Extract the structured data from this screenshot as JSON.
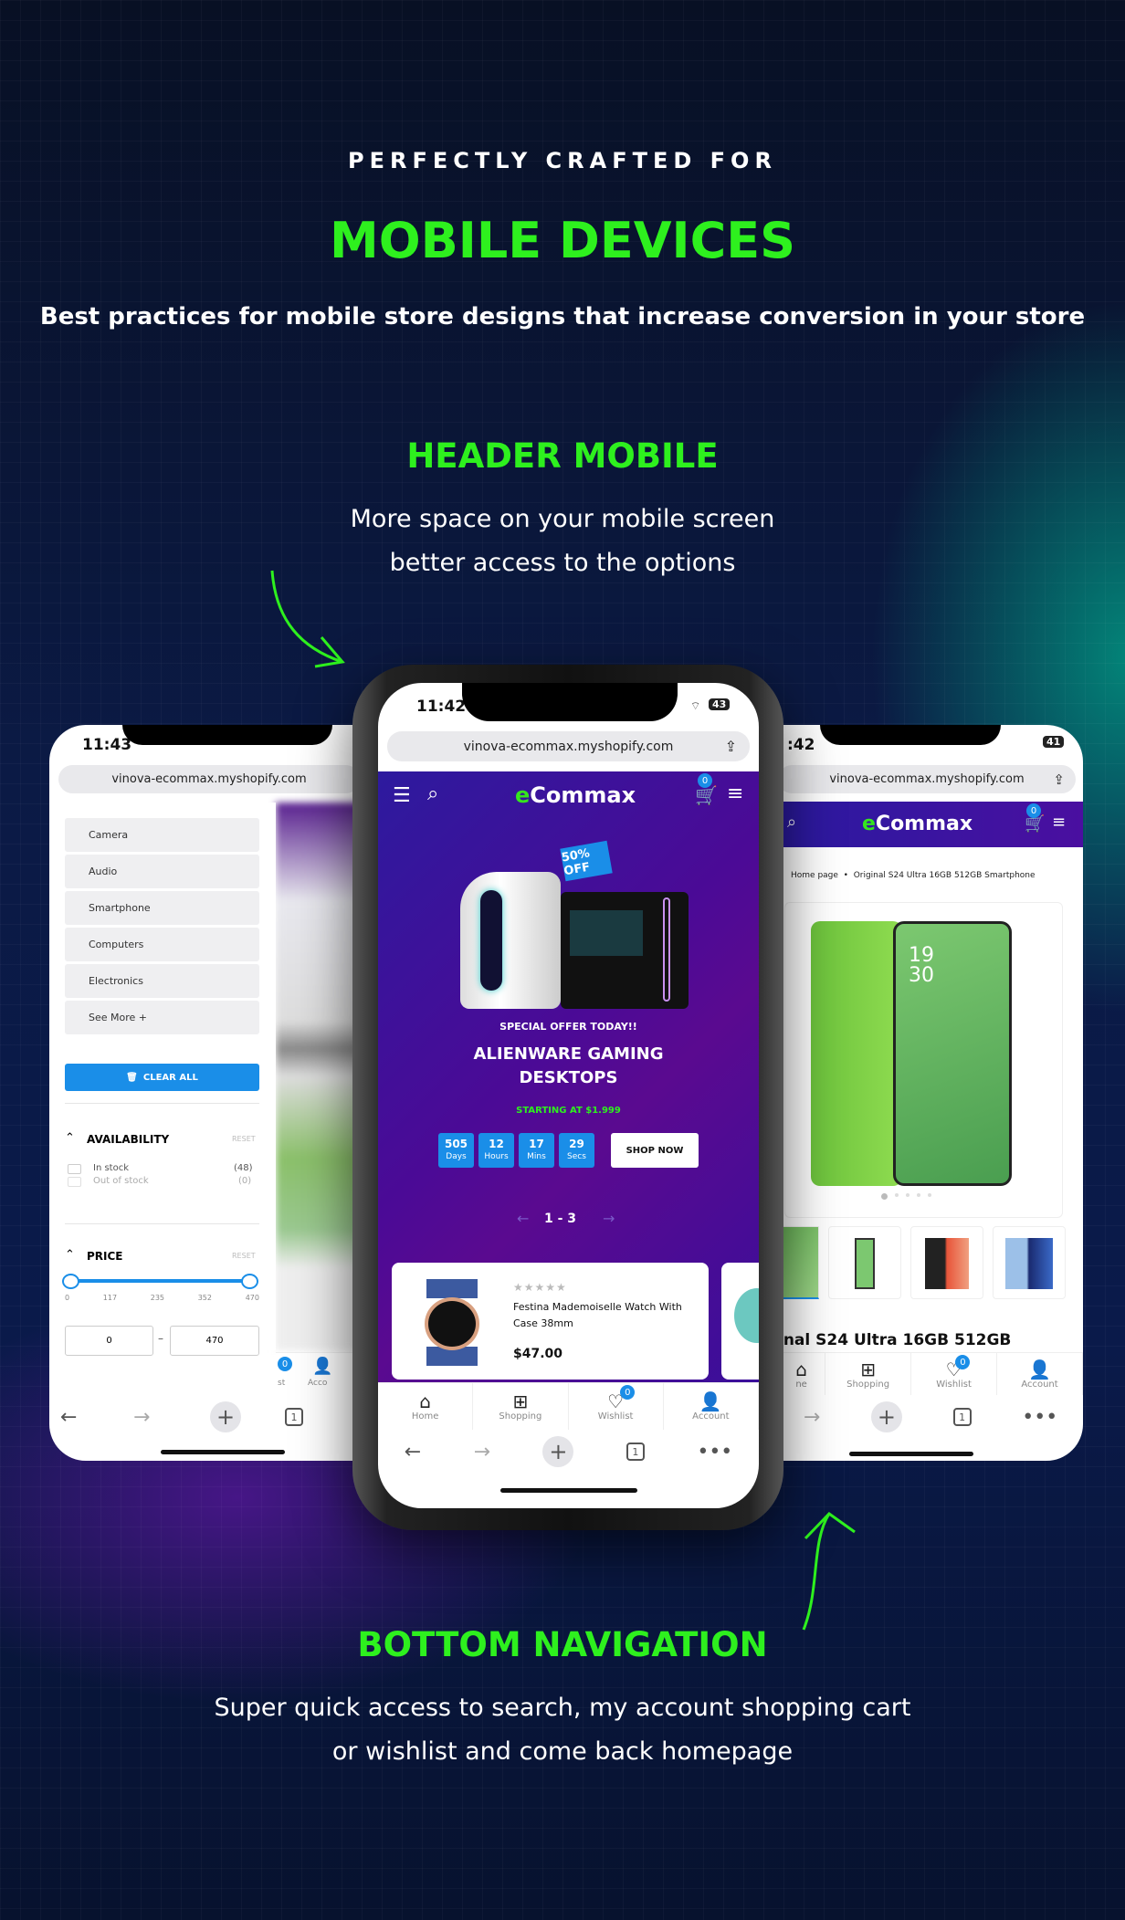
{
  "hero": {
    "kicker": "PERFECTLY CRAFTED FOR",
    "title": "MOBILE DEVICES",
    "subtitle": "Best practices for mobile store designs that increase conversion in your store"
  },
  "header_section": {
    "title": "HEADER MOBILE",
    "line1": "More space on your mobile screen",
    "line2": "better access to the options"
  },
  "bottom_section": {
    "title": "BOTTOM NAVIGATION",
    "line1": "Super quick access to search, my account shopping cart",
    "line2": "or wishlist and come back homepage"
  },
  "colors": {
    "accent_green": "#2ef01e",
    "brand_purple": "#4a0fa0",
    "badge_blue": "#1a8ee8"
  },
  "url": "vinova-ecommax.myshopify.com",
  "center_phone": {
    "time": "11:42",
    "battery": "43",
    "logo_prefix": "e",
    "logo_rest": "Commax",
    "cart_count": "0",
    "banner": {
      "badge": "50% OFF",
      "kicker": "SPECIAL OFFER TODAY!!",
      "title_line1": "ALIENWARE GAMING",
      "title_line2": "DESKTOPS",
      "price": "STARTING AT $1.999",
      "countdown": [
        {
          "value": "505",
          "unit": "Days"
        },
        {
          "value": "12",
          "unit": "Hours"
        },
        {
          "value": "17",
          "unit": "Mins"
        },
        {
          "value": "29",
          "unit": "Secs"
        }
      ],
      "cta": "SHOP NOW",
      "pagination": "1 - 3"
    },
    "product": {
      "rating": 0,
      "stars": "★★★★★",
      "name": "Festina Mademoiselle Watch With Case 38mm",
      "price": "$47.00"
    },
    "nav": [
      {
        "label": "Home",
        "icon": "home-icon"
      },
      {
        "label": "Shopping",
        "icon": "grid-icon"
      },
      {
        "label": "Wishlist",
        "icon": "heart-icon",
        "badge": "0"
      },
      {
        "label": "Account",
        "icon": "user-icon"
      }
    ],
    "tabs_count": "1"
  },
  "left_phone": {
    "time": "11:43",
    "categories": [
      "Camera",
      "Audio",
      "Smartphone",
      "Computers",
      "Electronics",
      "See More +"
    ],
    "clear_all": "CLEAR ALL",
    "availability": {
      "title": "AVAILABILITY",
      "reset": "RESET",
      "options": [
        {
          "label": "In stock",
          "count": "(48)"
        },
        {
          "label": "Out of stock",
          "count": "(0)"
        }
      ]
    },
    "price": {
      "title": "PRICE",
      "reset": "RESET",
      "ticks": [
        "0",
        "117",
        "235",
        "352",
        "470"
      ],
      "min": "0",
      "max": "470",
      "separator": "–"
    },
    "nav_partial": [
      "st",
      "Acco"
    ],
    "nav_badge": "0",
    "tabs_count": "1"
  },
  "right_phone": {
    "time": ":42",
    "battery": "41",
    "cart_count": "0",
    "breadcrumb": {
      "home": "Home page",
      "current": "Original S24 Ultra 16GB 512GB Smartphone"
    },
    "phone_clock": "19\n30",
    "product_title": "inal S24 Ultra 16GB 512GB",
    "nav": [
      {
        "label": "ne",
        "icon": "home-icon"
      },
      {
        "label": "Shopping",
        "icon": "grid-icon"
      },
      {
        "label": "Wishlist",
        "icon": "heart-icon",
        "badge": "0"
      },
      {
        "label": "Account",
        "icon": "user-icon"
      }
    ],
    "tabs_count": "1"
  }
}
